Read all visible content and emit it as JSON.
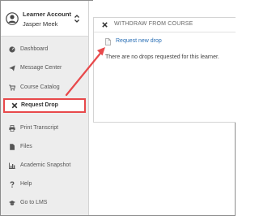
{
  "account": {
    "title": "Learner Account",
    "user": "Jasper Meek"
  },
  "sidebar": {
    "items": [
      {
        "label": "Dashboard",
        "icon": "dashboard-icon"
      },
      {
        "label": "Message Center",
        "icon": "send-icon"
      },
      {
        "label": "Course Catalog",
        "icon": "cart-icon"
      },
      {
        "label": "Request Drop",
        "icon": "close-icon",
        "active": true
      },
      {
        "label": "Print Transcript",
        "icon": "print-icon"
      },
      {
        "label": "Files",
        "icon": "file-icon"
      },
      {
        "label": "Academic Snapshot",
        "icon": "bar-chart-icon"
      },
      {
        "label": "Help",
        "icon": "question-icon"
      },
      {
        "label": "Go to LMS",
        "icon": "graduation-cap-icon"
      }
    ]
  },
  "panel": {
    "title": "WITHDRAW FROM COURSE",
    "link_label": "Request new drop",
    "empty_message": "There are no drops requested for this learner."
  },
  "colors": {
    "highlight": "#e8494b",
    "link": "#2a6fb5",
    "sidebar_bg": "#ededed"
  }
}
